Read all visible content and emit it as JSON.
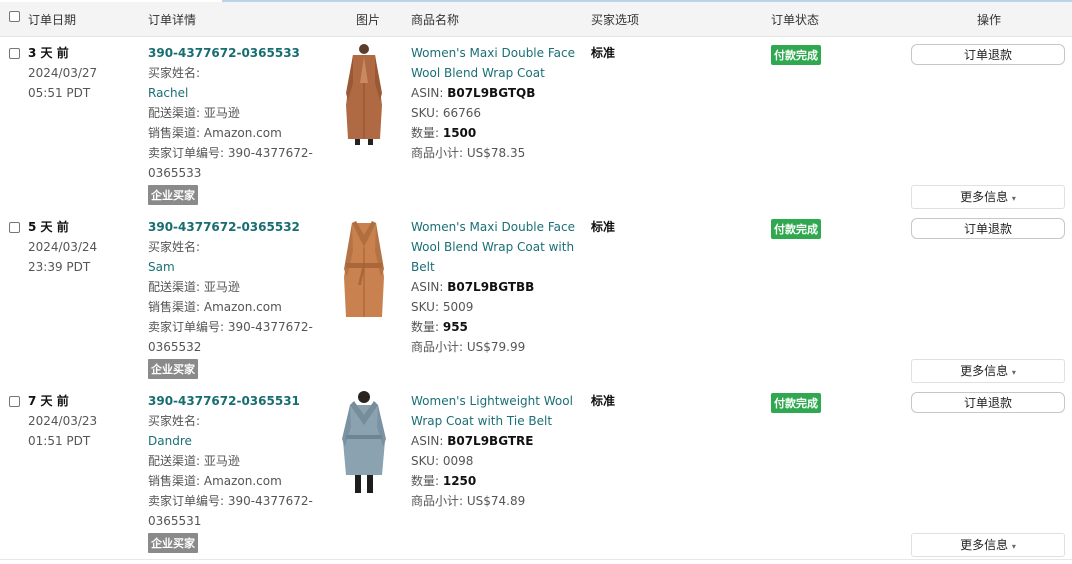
{
  "header": {
    "col_date": "订单日期",
    "col_details": "订单详情",
    "col_image": "图片",
    "col_product": "商品名称",
    "col_option": "买家选项",
    "col_status": "订单状态",
    "col_action": "操作"
  },
  "labels": {
    "buyer_name": "买家姓名:",
    "delivery": "配送渠道: 亚马逊",
    "sales": "销售渠道: Amazon.com",
    "seller_order_prefix": "卖家订单编号: 390-4377672-",
    "asin": "ASIN: ",
    "sku": "SKU: ",
    "qty": "数量: ",
    "subtotal": "商品小计: ",
    "business_buyer": "企业买家",
    "refund": "订单退款",
    "more": "更多信息",
    "more_caret": "▾"
  },
  "orders": [
    {
      "age": "3 天 前",
      "date": "2024/03/27",
      "time": "05:51 PDT",
      "order_id": "390-4377672-0365533",
      "buyer": "Rachel",
      "seller_order_suffix": "0365533",
      "product_line1": "Women's Maxi Double Face",
      "product_line2": "Wool Blend Wrap Coat",
      "product_line3": "",
      "asin": "B07L9BGTQB",
      "sku": "66766",
      "qty": "1500",
      "subtotal": "US$78.35",
      "option": "标准",
      "status": "付款完成",
      "image": "coat-tan-icon"
    },
    {
      "age": "5 天 前",
      "date": "2024/03/24",
      "time": "23:39 PDT",
      "order_id": "390-4377672-0365532",
      "buyer": "Sam",
      "seller_order_suffix": "0365532",
      "product_line1": "Women's Maxi Double Face",
      "product_line2": "Wool Blend Wrap Coat with",
      "product_line3": "Belt",
      "asin": "B07L9BGTBB",
      "sku": "5009",
      "qty": "955",
      "subtotal": "US$79.99",
      "option": "标准",
      "status": "付款完成",
      "image": "coat-camel-icon"
    },
    {
      "age": "7 天 前",
      "date": "2024/03/23",
      "time": "01:51 PDT",
      "order_id": "390-4377672-0365531",
      "buyer": "Dandre",
      "seller_order_suffix": "0365531",
      "product_line1": "Women's Lightweight Wool",
      "product_line2": "Wrap Coat with Tie Belt",
      "product_line3": "",
      "asin": "B07L9BGTRE",
      "sku": "0098",
      "qty": "1250",
      "subtotal": "US$74.89",
      "option": "标准",
      "status": "付款完成",
      "image": "coat-grey-icon"
    }
  ],
  "colors": {
    "link": "#1a6f76",
    "paid_badge": "#2fa84f",
    "business_badge": "#8a8a8a"
  }
}
